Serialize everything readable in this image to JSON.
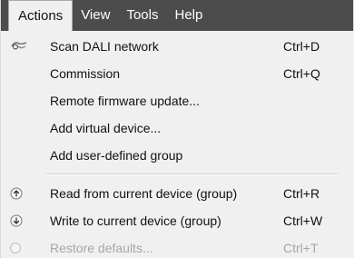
{
  "menubar": {
    "items": [
      {
        "label": "Actions"
      },
      {
        "label": "View"
      },
      {
        "label": "Tools"
      },
      {
        "label": "Help"
      }
    ]
  },
  "actions_menu": {
    "items": [
      {
        "label": "Scan DALI network",
        "shortcut": "Ctrl+D",
        "icon": "scan-icon",
        "enabled": true
      },
      {
        "label": "Commission",
        "shortcut": "Ctrl+Q",
        "icon": "",
        "enabled": true
      },
      {
        "label": "Remote firmware update...",
        "shortcut": "",
        "icon": "",
        "enabled": true
      },
      {
        "label": "Add virtual device...",
        "shortcut": "",
        "icon": "",
        "enabled": true
      },
      {
        "label": "Add user-defined group",
        "shortcut": "",
        "icon": "",
        "enabled": true
      },
      {
        "label": "Read from current device (group)",
        "shortcut": "Ctrl+R",
        "icon": "read-icon",
        "enabled": true
      },
      {
        "label": "Write to current device (group)",
        "shortcut": "Ctrl+W",
        "icon": "write-icon",
        "enabled": true
      },
      {
        "label": "Restore defaults...",
        "shortcut": "Ctrl+T",
        "icon": "restore-icon",
        "enabled": false
      }
    ]
  },
  "colors": {
    "menubar_background": "#4c4c4c",
    "menu_background": "#f0f0f0",
    "menu_text": "#111111",
    "disabled_text": "#a6a6a6",
    "separator": "#cfcfcf"
  }
}
